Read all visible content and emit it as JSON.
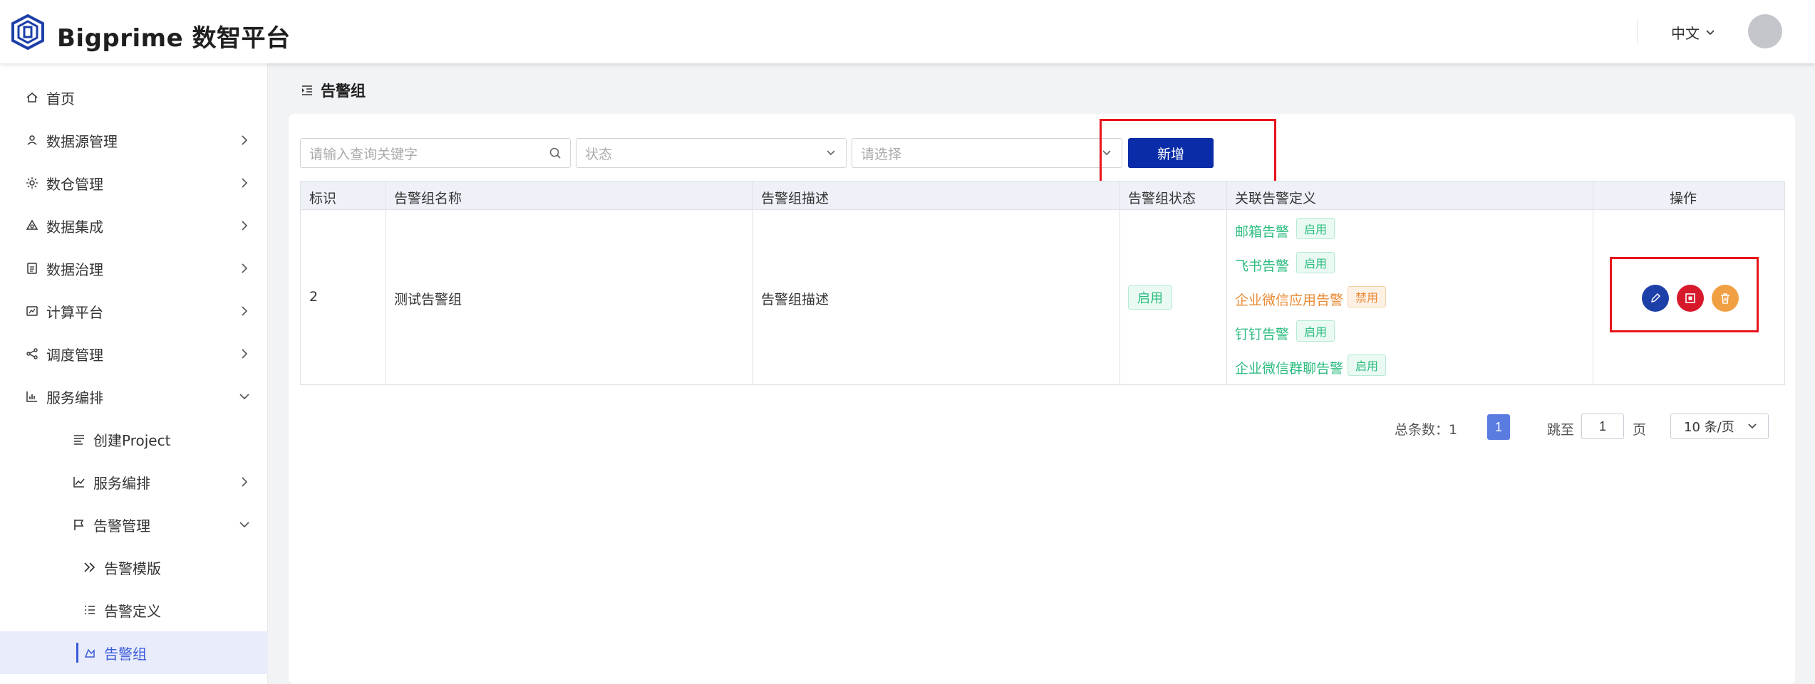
{
  "header": {
    "brand": "Bigprime 数智平台",
    "language": "中文"
  },
  "sidebar": {
    "items": [
      {
        "label": "首页",
        "icon": "home-icon"
      },
      {
        "label": "数据源管理",
        "icon": "datasource-icon"
      },
      {
        "label": "数仓管理",
        "icon": "warehouse-icon"
      },
      {
        "label": "数据集成",
        "icon": "integration-icon"
      },
      {
        "label": "数据治理",
        "icon": "governance-icon"
      },
      {
        "label": "计算平台",
        "icon": "compute-icon"
      },
      {
        "label": "调度管理",
        "icon": "schedule-icon"
      },
      {
        "label": "服务编排",
        "icon": "bar-chart-icon"
      },
      {
        "label": "创建Project",
        "icon": "list-icon"
      },
      {
        "label": "服务编排",
        "icon": "line-chart-icon"
      },
      {
        "label": "告警管理",
        "icon": "flag-icon"
      },
      {
        "label": "告警模版",
        "icon": "double-chevron-icon"
      },
      {
        "label": "告警定义",
        "icon": "ordered-list-icon"
      },
      {
        "label": "告警组",
        "icon": "alarm-group-icon"
      }
    ]
  },
  "page": {
    "title": "告警组"
  },
  "filters": {
    "keyword_placeholder": "请输入查询关键字",
    "status_placeholder": "状态",
    "select_placeholder": "请选择",
    "add_label": "新增"
  },
  "table": {
    "headers": [
      "标识",
      "告警组名称",
      "告警组描述",
      "告警组状态",
      "关联告警定义",
      "操作"
    ],
    "rows": [
      {
        "id": "2",
        "name": "测试告警组",
        "description": "告警组描述",
        "status": "启用",
        "related": [
          {
            "name": "邮箱告警",
            "status": "启用"
          },
          {
            "name": "飞书告警",
            "status": "启用"
          },
          {
            "name": "企业微信应用告警",
            "status": "禁用"
          },
          {
            "name": "钉钉告警",
            "status": "启用"
          },
          {
            "name": "企业微信群聊告警",
            "status": "启用"
          }
        ]
      }
    ]
  },
  "pagination": {
    "total_label": "总条数：1",
    "current_page": "1",
    "jump_label": "跳至",
    "jump_value": "1",
    "page_suffix": "页",
    "page_size": "10 条/页"
  },
  "colors": {
    "primary": "#0a2ca8",
    "enabled": "#2cbc7f",
    "disabled": "#ea8b35",
    "edit": "#1d3fa8",
    "stop": "#d6192b",
    "delete": "#f0a042"
  }
}
